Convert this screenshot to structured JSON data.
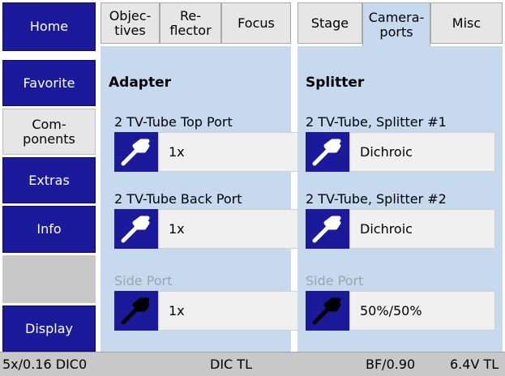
{
  "nav": {
    "home": "Home",
    "favorite": "Favorite",
    "components": "Com-\nponents",
    "extras": "Extras",
    "info": "Info",
    "display": "Display"
  },
  "tabs": {
    "objectives": "Objec-\ntives",
    "reflector": "Re-\nflector",
    "focus": "Focus",
    "stage": "Stage",
    "cameraports": "Camera-\nports",
    "misc": "Misc"
  },
  "adapter": {
    "heading": "Adapter",
    "top_port": {
      "label": "2 TV-Tube Top Port",
      "value": "1x"
    },
    "back_port": {
      "label": "2 TV-Tube Back Port",
      "value": "1x"
    },
    "side_port": {
      "label": "Side Port",
      "value": "1x"
    }
  },
  "splitter": {
    "heading": "Splitter",
    "splitter1": {
      "label": "2 TV-Tube, Splitter #1",
      "value": "Dichroic"
    },
    "splitter2": {
      "label": "2 TV-Tube, Splitter #2",
      "value": "Dichroic"
    },
    "side_port": {
      "label": "Side Port",
      "value": "50%/50%"
    }
  },
  "status": {
    "objective": "5x/0.16 DIC0",
    "dic": "DIC TL",
    "bf": "BF/0.90",
    "voltage": "6.4V TL"
  },
  "icons": {
    "wrench": "wrench-icon"
  },
  "colors": {
    "nav_blue": "#1a1a9a",
    "panel_blue": "#c6d9ef",
    "button_gray": "#f0f0f0",
    "status_gray": "#c8c8c8"
  }
}
